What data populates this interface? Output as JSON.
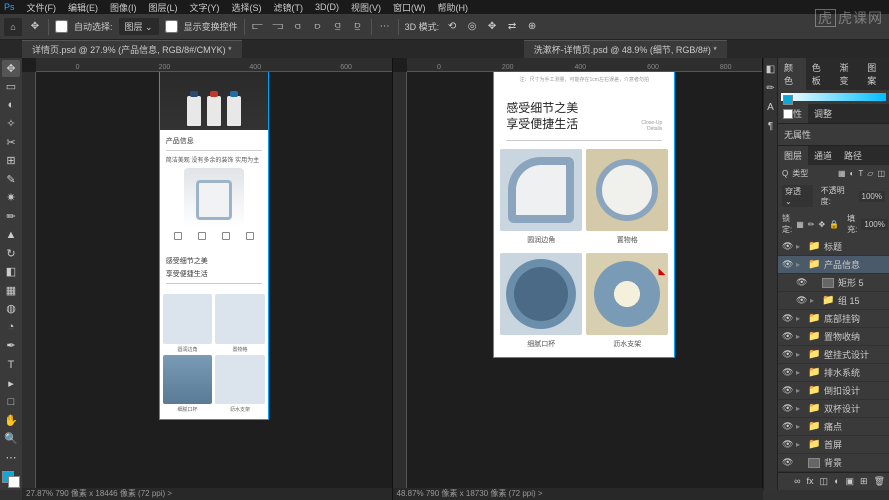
{
  "menu": {
    "items": [
      "文件(F)",
      "编辑(E)",
      "图像(I)",
      "图层(L)",
      "文字(Y)",
      "选择(S)",
      "滤镜(T)",
      "3D(D)",
      "视图(V)",
      "窗口(W)",
      "帮助(H)"
    ]
  },
  "options": {
    "autoSelect": "自动选择:",
    "autoSelectValue": "图层",
    "showTransform": "显示变换控件"
  },
  "tabs": {
    "tab1": "详情页.psd @ 27.9% (产品信息, RGB/8#/CMYK) *",
    "tab2": "洗漱杯-详情页.psd @ 48.9% (细节, RGB/8#) *"
  },
  "artboard1": {
    "sec1_title": "产品信息",
    "sec1_desc": "简洁美观  没有多余的装饰  实用为主",
    "sec2_title1": "感受细节之美",
    "sec2_title2": "享受便捷生活",
    "cap1": "圆润边角",
    "cap2": "置物格",
    "cap3": "细腻口杯",
    "cap4": "沥水支架"
  },
  "artboard2": {
    "topnote": "注：尺寸为手工测量，可能存在1cm左右误差，介意者勿拍",
    "headline1": "感受细节之美",
    "headline2": "享受便捷生活",
    "headline_en1": "Close-Up",
    "headline_en2": "Details",
    "cap1": "圆润边角",
    "cap2": "置物格",
    "cap3": "细腻口杯",
    "cap4": "沥水支架"
  },
  "panels": {
    "colorTab": "颜色",
    "swatchTab": "色板",
    "gradTab": "渐变",
    "patTab": "图案",
    "propTab": "属性",
    "adjTab": "调整",
    "noProp": "无属性",
    "layersTab": "图层",
    "channelsTab": "通道",
    "pathsTab": "路径",
    "kind": "类型",
    "blend": "穿透",
    "opacityLabel": "不透明度:",
    "opacity": "100%",
    "lockLabel": "锁定:",
    "fillLabel": "填充:",
    "fill": "100%"
  },
  "layers": [
    {
      "name": "标题",
      "folder": true,
      "vis": true
    },
    {
      "name": "产品信息",
      "folder": true,
      "vis": true,
      "sel": true
    },
    {
      "name": "矩形 5",
      "folder": false,
      "vis": true,
      "indent": 1
    },
    {
      "name": "组 15",
      "folder": true,
      "vis": true,
      "indent": 1
    },
    {
      "name": "底部挂钩",
      "folder": true,
      "vis": true
    },
    {
      "name": "置物收纳",
      "folder": true,
      "vis": true
    },
    {
      "name": "壁挂式设计",
      "folder": true,
      "vis": true
    },
    {
      "name": "排水系统",
      "folder": true,
      "vis": true
    },
    {
      "name": "倒扣设计",
      "folder": true,
      "vis": true
    },
    {
      "name": "双杯设计",
      "folder": true,
      "vis": true
    },
    {
      "name": "痛点",
      "folder": true,
      "vis": true
    },
    {
      "name": "首屏",
      "folder": true,
      "vis": true
    },
    {
      "name": "背景",
      "folder": false,
      "vis": true
    }
  ],
  "status": {
    "left": "27.87%   790 像素 x 18446 像素 (72 ppi)   >",
    "right": "48.87%   790 像素 x 18730 像素 (72 ppi)   >"
  },
  "watermark": {
    "brand": "虎课网"
  }
}
